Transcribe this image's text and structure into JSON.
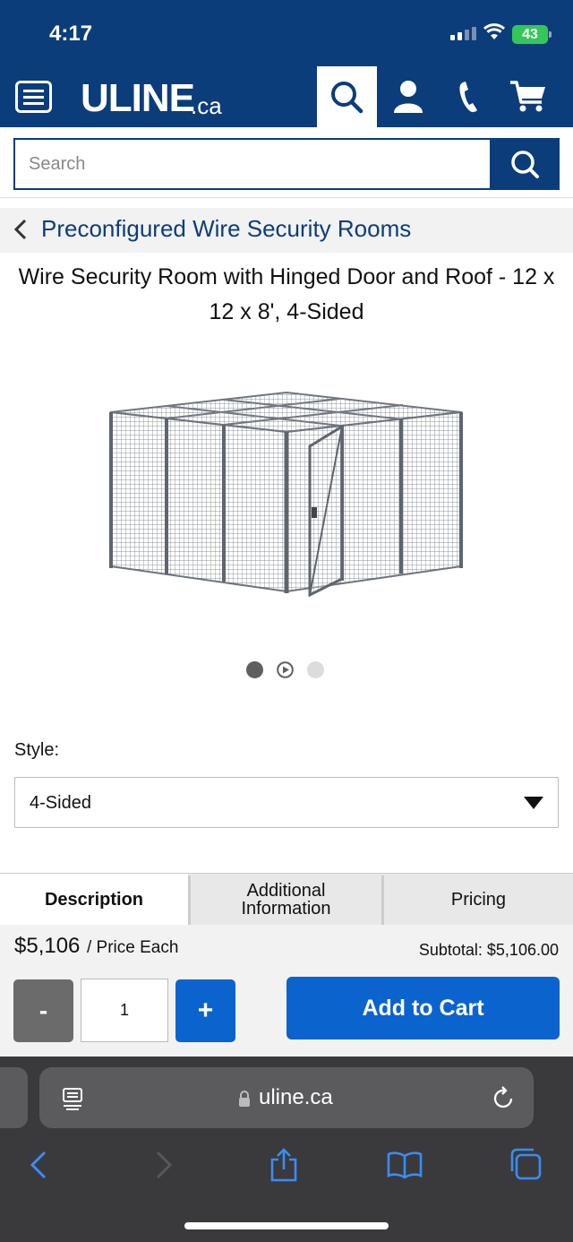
{
  "status_bar": {
    "time": "4:17",
    "battery": "43"
  },
  "header": {
    "logo": "ULINE",
    "logo_suffix": ".ca",
    "icons": [
      "menu-icon",
      "search-icon",
      "account-icon",
      "phone-icon",
      "cart-icon"
    ]
  },
  "search": {
    "placeholder": "Search",
    "value": ""
  },
  "breadcrumb": {
    "label": "Preconfigured Wire Security Rooms"
  },
  "product": {
    "title": "Wire Security Room with Hinged Door and Roof - 12 x 12 x 8', 4-Sided",
    "image_count": 3,
    "active_image": 1
  },
  "style": {
    "label": "Style:",
    "selected": "4-Sided"
  },
  "tabs": [
    {
      "label": "Description",
      "active": true
    },
    {
      "label": "Additional Information",
      "active": false
    },
    {
      "label": "Pricing",
      "active": false
    }
  ],
  "pricing": {
    "price": "$5,106",
    "price_suffix": "/ Price Each",
    "subtotal": "Subtotal: $5,106.00",
    "quantity": "1",
    "minus_label": "-",
    "plus_label": "+",
    "add_to_cart_label": "Add to Cart"
  },
  "browser": {
    "url": "uline.ca"
  },
  "colors": {
    "brand_navy": "#0b3d7a",
    "action_blue": "#0b63ce",
    "safari_bar": "#3a3a3c"
  }
}
